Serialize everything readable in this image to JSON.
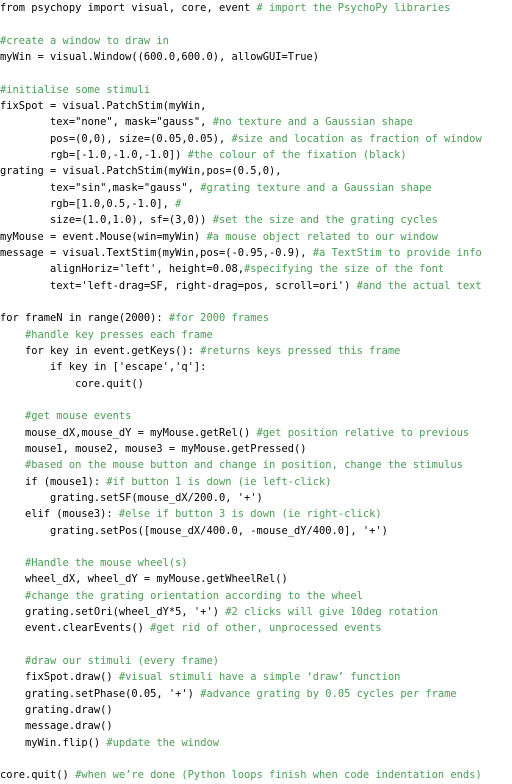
{
  "document": {
    "kind": "source-code-listing",
    "language": "Python",
    "colors": {
      "background": "#ffffff",
      "code_text": "#000000",
      "comment_text": "#4a9e55"
    },
    "lines": [
      {
        "index": 0,
        "segments": [
          {
            "type": "code",
            "text": "from psychopy import visual, core, event "
          },
          {
            "type": "comment",
            "text": "# import the PsychoPy libraries"
          }
        ]
      },
      {
        "index": 1,
        "segments": [
          {
            "type": "code",
            "text": ""
          }
        ]
      },
      {
        "index": 2,
        "segments": [
          {
            "type": "comment",
            "text": "#create a window to draw in"
          }
        ]
      },
      {
        "index": 3,
        "segments": [
          {
            "type": "code",
            "text": "myWin = visual.Window((600.0,600.0), allowGUI=True)"
          }
        ]
      },
      {
        "index": 4,
        "segments": [
          {
            "type": "code",
            "text": ""
          }
        ]
      },
      {
        "index": 5,
        "segments": [
          {
            "type": "comment",
            "text": "#initialise some stimuli"
          }
        ]
      },
      {
        "index": 6,
        "segments": [
          {
            "type": "code",
            "text": "fixSpot = visual.PatchStim(myWin,"
          }
        ]
      },
      {
        "index": 7,
        "segments": [
          {
            "type": "code",
            "text": "        tex=\"none\", mask=\"gauss\", "
          },
          {
            "type": "comment",
            "text": "#no texture and a Gaussian shape"
          }
        ]
      },
      {
        "index": 8,
        "segments": [
          {
            "type": "code",
            "text": "        pos=(0,0), size=(0.05,0.05), "
          },
          {
            "type": "comment",
            "text": "#size and location as fraction of window"
          }
        ]
      },
      {
        "index": 9,
        "segments": [
          {
            "type": "code",
            "text": "        rgb=[-1.0,-1.0,-1.0]) "
          },
          {
            "type": "comment",
            "text": "#the colour of the fixation (black)"
          }
        ]
      },
      {
        "index": 10,
        "segments": [
          {
            "type": "code",
            "text": "grating = visual.PatchStim(myWin,pos=(0.5,0),"
          }
        ]
      },
      {
        "index": 11,
        "segments": [
          {
            "type": "code",
            "text": "        tex=\"sin\",mask=\"gauss\", "
          },
          {
            "type": "comment",
            "text": "#grating texture and a Gaussian shape"
          }
        ]
      },
      {
        "index": 12,
        "segments": [
          {
            "type": "code",
            "text": "        rgb=[1.0,0.5,-1.0], "
          },
          {
            "type": "comment",
            "text": "#"
          }
        ]
      },
      {
        "index": 13,
        "segments": [
          {
            "type": "code",
            "text": "        size=(1.0,1.0), sf=(3,0)) "
          },
          {
            "type": "comment",
            "text": "#set the size and the grating cycles"
          }
        ]
      },
      {
        "index": 14,
        "segments": [
          {
            "type": "code",
            "text": "myMouse = event.Mouse(win=myWin) "
          },
          {
            "type": "comment",
            "text": "#a mouse object related to our window"
          }
        ]
      },
      {
        "index": 15,
        "segments": [
          {
            "type": "code",
            "text": "message = visual.TextStim(myWin,pos=(-0.95,-0.9), "
          },
          {
            "type": "comment",
            "text": "#a TextStim to provide info"
          }
        ]
      },
      {
        "index": 16,
        "segments": [
          {
            "type": "code",
            "text": "        alignHoriz='left', height=0.08,"
          },
          {
            "type": "comment",
            "text": "#specifying the size of the font"
          }
        ]
      },
      {
        "index": 17,
        "segments": [
          {
            "type": "code",
            "text": "        text='left-drag=SF, right-drag=pos, scroll=ori') "
          },
          {
            "type": "comment",
            "text": "#and the actual text"
          }
        ]
      },
      {
        "index": 18,
        "segments": [
          {
            "type": "code",
            "text": ""
          }
        ]
      },
      {
        "index": 19,
        "segments": [
          {
            "type": "code",
            "text": "for frameN in range(2000): "
          },
          {
            "type": "comment",
            "text": "#for 2000 frames"
          }
        ]
      },
      {
        "index": 20,
        "segments": [
          {
            "type": "comment",
            "text": "    #handle key presses each frame"
          }
        ]
      },
      {
        "index": 21,
        "segments": [
          {
            "type": "code",
            "text": "    for key in event.getKeys(): "
          },
          {
            "type": "comment",
            "text": "#returns keys pressed this frame"
          }
        ]
      },
      {
        "index": 22,
        "segments": [
          {
            "type": "code",
            "text": "        if key in ['escape','q']:"
          }
        ]
      },
      {
        "index": 23,
        "segments": [
          {
            "type": "code",
            "text": "            core.quit()"
          }
        ]
      },
      {
        "index": 24,
        "segments": [
          {
            "type": "code",
            "text": ""
          }
        ]
      },
      {
        "index": 25,
        "segments": [
          {
            "type": "comment",
            "text": "    #get mouse events"
          }
        ]
      },
      {
        "index": 26,
        "segments": [
          {
            "type": "code",
            "text": "    mouse_dX,mouse_dY = myMouse.getRel() "
          },
          {
            "type": "comment",
            "text": "#get position relative to previous"
          }
        ]
      },
      {
        "index": 27,
        "segments": [
          {
            "type": "code",
            "text": "    mouse1, mouse2, mouse3 = myMouse.getPressed()"
          }
        ]
      },
      {
        "index": 28,
        "segments": [
          {
            "type": "comment",
            "text": "    #based on the mouse button and change in position, change the stimulus"
          }
        ]
      },
      {
        "index": 29,
        "segments": [
          {
            "type": "code",
            "text": "    if (mouse1): "
          },
          {
            "type": "comment",
            "text": "#if button 1 is down (ie left-click)"
          }
        ]
      },
      {
        "index": 30,
        "segments": [
          {
            "type": "code",
            "text": "        grating.setSF(mouse_dX/200.0, '+')"
          }
        ]
      },
      {
        "index": 31,
        "segments": [
          {
            "type": "code",
            "text": "    elif (mouse3): "
          },
          {
            "type": "comment",
            "text": "#else if button 3 is down (ie right-click)"
          }
        ]
      },
      {
        "index": 32,
        "segments": [
          {
            "type": "code",
            "text": "        grating.setPos([mouse_dX/400.0, -mouse_dY/400.0], '+')"
          }
        ]
      },
      {
        "index": 33,
        "segments": [
          {
            "type": "code",
            "text": ""
          }
        ]
      },
      {
        "index": 34,
        "segments": [
          {
            "type": "comment",
            "text": "    #Handle the mouse wheel(s)"
          }
        ]
      },
      {
        "index": 35,
        "segments": [
          {
            "type": "code",
            "text": "    wheel_dX, wheel_dY = myMouse.getWheelRel()"
          }
        ]
      },
      {
        "index": 36,
        "segments": [
          {
            "type": "comment",
            "text": "    #change the grating orientation according to the wheel"
          }
        ]
      },
      {
        "index": 37,
        "segments": [
          {
            "type": "code",
            "text": "    grating.setOri(wheel_dY*5, '+') "
          },
          {
            "type": "comment",
            "text": "#2 clicks will give 10deg rotation"
          }
        ]
      },
      {
        "index": 38,
        "segments": [
          {
            "type": "code",
            "text": "    event.clearEvents() "
          },
          {
            "type": "comment",
            "text": "#get rid of other, unprocessed events"
          }
        ]
      },
      {
        "index": 39,
        "segments": [
          {
            "type": "code",
            "text": ""
          }
        ]
      },
      {
        "index": 40,
        "segments": [
          {
            "type": "comment",
            "text": "    #draw our stimuli (every frame)"
          }
        ]
      },
      {
        "index": 41,
        "segments": [
          {
            "type": "code",
            "text": "    fixSpot.draw() "
          },
          {
            "type": "comment",
            "text": "#visual stimuli have a simple ‘draw’ function"
          }
        ]
      },
      {
        "index": 42,
        "segments": [
          {
            "type": "code",
            "text": "    grating.setPhase(0.05, '+') "
          },
          {
            "type": "comment",
            "text": "#advance grating by 0.05 cycles per frame"
          }
        ]
      },
      {
        "index": 43,
        "segments": [
          {
            "type": "code",
            "text": "    grating.draw()"
          }
        ]
      },
      {
        "index": 44,
        "segments": [
          {
            "type": "code",
            "text": "    message.draw()"
          }
        ]
      },
      {
        "index": 45,
        "segments": [
          {
            "type": "code",
            "text": "    myWin.flip() "
          },
          {
            "type": "comment",
            "text": "#update the window"
          }
        ]
      },
      {
        "index": 46,
        "segments": [
          {
            "type": "code",
            "text": ""
          }
        ]
      },
      {
        "index": 47,
        "segments": [
          {
            "type": "code",
            "text": "core.quit() "
          },
          {
            "type": "comment",
            "text": "#when we’re done (Python loops finish when code indentation ends)"
          }
        ]
      }
    ]
  }
}
